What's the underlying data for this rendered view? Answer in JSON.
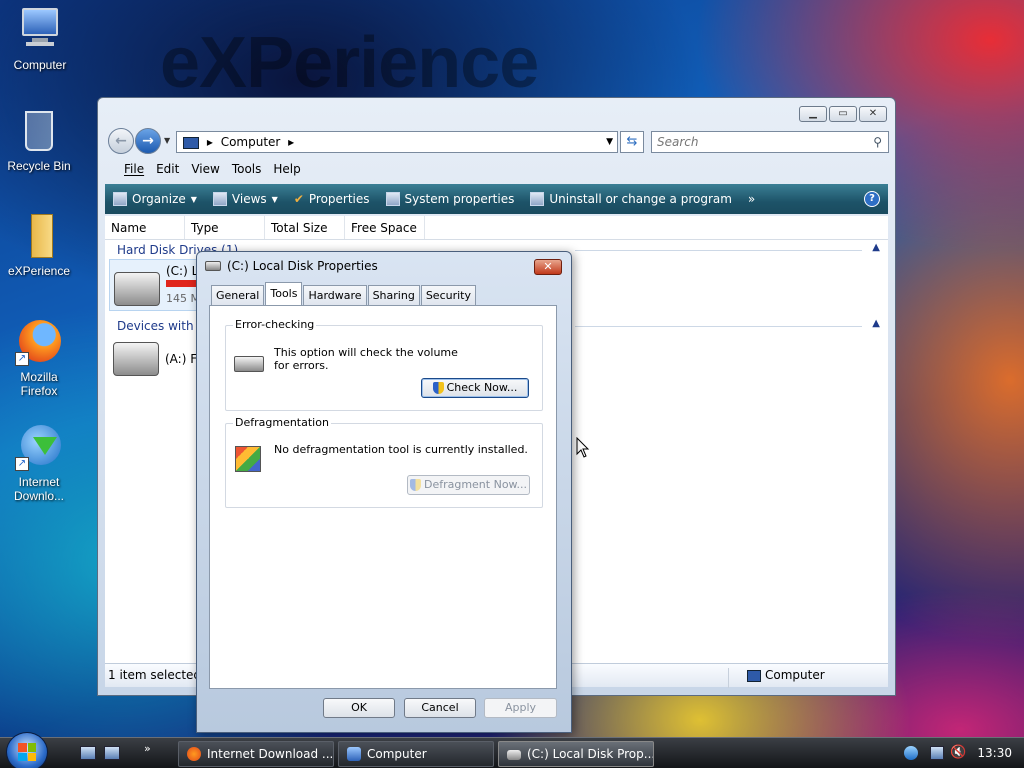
{
  "wallpaper": {
    "watermark": "eXPerience"
  },
  "desktop_icons": [
    {
      "label": "Computer"
    },
    {
      "label": "Recycle Bin"
    },
    {
      "label": "eXPerience"
    },
    {
      "label": "Mozilla Firefox"
    },
    {
      "label": "Internet Downlo..."
    }
  ],
  "explorer": {
    "address": {
      "location": "Computer",
      "separator": "▸"
    },
    "search_placeholder": "Search",
    "menu": [
      "File",
      "Edit",
      "View",
      "Tools",
      "Help"
    ],
    "toolbar": {
      "organize": "Organize",
      "views": "Views",
      "properties": "Properties",
      "system_properties": "System properties",
      "uninstall": "Uninstall or change a program",
      "more": "»"
    },
    "columns": [
      "Name",
      "Type",
      "Total Size",
      "Free Space"
    ],
    "groups": {
      "hard_disk": "Hard Disk Drives (1)",
      "removable": "Devices with Re"
    },
    "items": {
      "c_drive_name": "(C:) L",
      "c_drive_size": "145 M",
      "a_drive_name": "(A:) F"
    },
    "status": {
      "left": "1 item selected",
      "right": "Computer"
    }
  },
  "dialog": {
    "title": "(C:) Local Disk Properties",
    "tabs": [
      "General",
      "Tools",
      "Hardware",
      "Sharing",
      "Security"
    ],
    "active_tab": "Tools",
    "error_checking": {
      "label": "Error-checking",
      "text": "This option will check the volume for errors.",
      "button": "Check Now..."
    },
    "defrag": {
      "label": "Defragmentation",
      "text": "No defragmentation tool is currently installed.",
      "button": "Defragment Now..."
    },
    "buttons": {
      "ok": "OK",
      "cancel": "Cancel",
      "apply": "Apply"
    }
  },
  "taskbar": {
    "tasks": [
      {
        "label": "Internet Download ..."
      },
      {
        "label": "Computer"
      },
      {
        "label": "(C:) Local Disk Prop..."
      }
    ],
    "overflow": "»",
    "clock": "13:30"
  },
  "colors": {
    "toolbar": "#1d5368",
    "title_close": "#c1391b",
    "group_header": "#1e3a8a"
  }
}
